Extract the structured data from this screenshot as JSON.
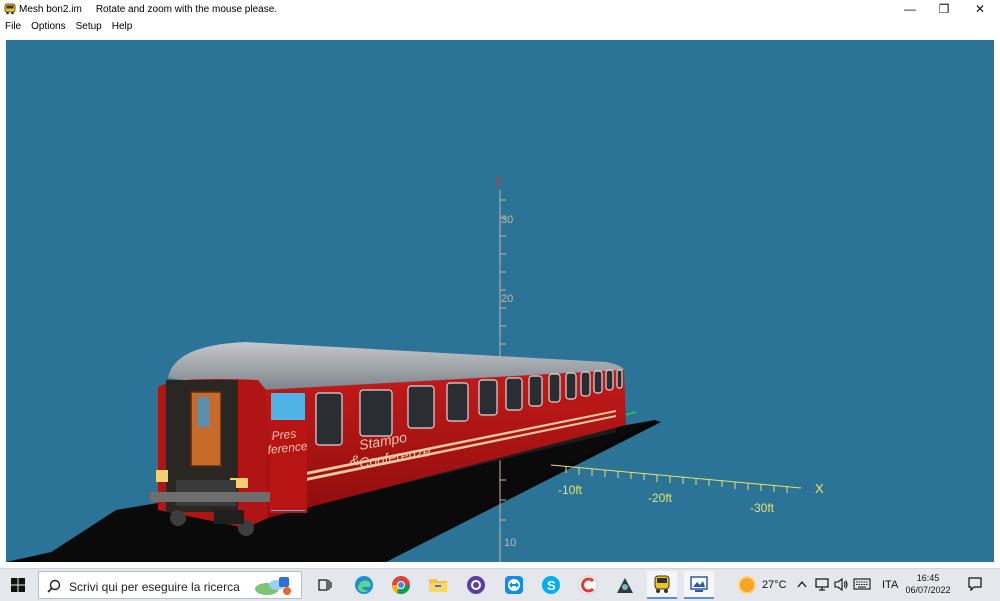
{
  "window": {
    "app_name": "Mesh bon2.im",
    "hint": "Rotate and zoom with the mouse please.",
    "controls": {
      "minimize": "—",
      "restore": "❐",
      "close": "✕"
    }
  },
  "menubar": {
    "items": [
      "File",
      "Options",
      "Setup",
      "Help"
    ]
  },
  "viewport": {
    "background_color": "#2b7497",
    "axes": {
      "z_label": "Z",
      "x_label": "X",
      "z_ticks": [
        "30",
        "20",
        "10"
      ],
      "x_ticks": [
        "-10ft",
        "-20ft",
        "-30ft"
      ],
      "color": "#e8e26a"
    },
    "coach": {
      "body_color": "#b81414",
      "roof_color": "#9aa0a6",
      "livery_text": [
        "Stampo",
        "Conferenze"
      ],
      "livery_ampersand": "&",
      "end_text": [
        "Pres",
        "ference"
      ]
    }
  },
  "taskbar": {
    "start_icon": "windows-logo-icon",
    "search_placeholder": "Scrivi qui per eseguire la ricerca",
    "apps": [
      "task-view-icon",
      "edge-icon",
      "chrome-icon",
      "file-explorer-icon",
      "github-desktop-icon",
      "teamviewer-icon",
      "skype-icon",
      "ccleaner-icon",
      "game-app-icon",
      "mesh-viewer-icon",
      "image-tool-icon"
    ],
    "weather": {
      "temp": "27°C"
    },
    "language": "ITA",
    "clock": {
      "time": "16:45",
      "date": "06/07/2022"
    }
  }
}
